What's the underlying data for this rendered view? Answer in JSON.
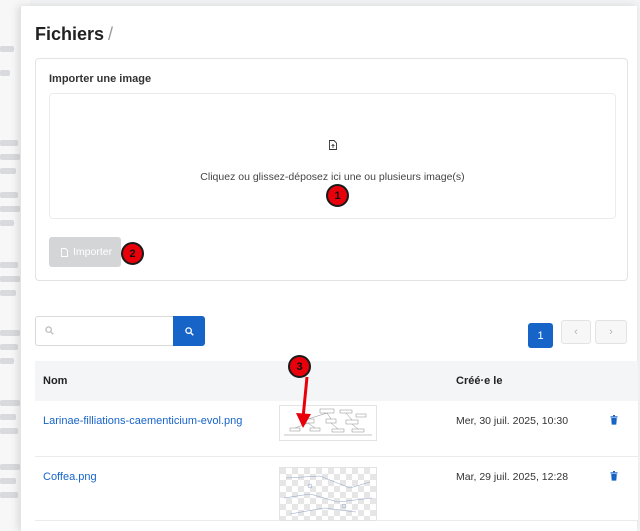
{
  "page": {
    "title": "Fichiers",
    "separator": "/"
  },
  "upload": {
    "label": "Importer une image",
    "drop_text": "Cliquez ou glissez-déposez ici une ou plusieurs image(s)",
    "import_button": "Importer"
  },
  "search": {
    "placeholder": ""
  },
  "pagination": {
    "current": "1",
    "prev": "‹",
    "next": "›"
  },
  "table": {
    "columns": {
      "name": "Nom",
      "created": "Créé·e le"
    },
    "rows": [
      {
        "name": "Larinae-filliations-caementicium-evol.png",
        "created": "Mer, 30 juil. 2025, 10:30"
      },
      {
        "name": "Coffea.png",
        "created": "Mar, 29 juil. 2025, 12:28"
      }
    ]
  },
  "markers": [
    "1",
    "2",
    "3"
  ],
  "colors": {
    "primary": "#1764c8",
    "marker": "#e8000b",
    "disabled": "#d4d5d7"
  }
}
